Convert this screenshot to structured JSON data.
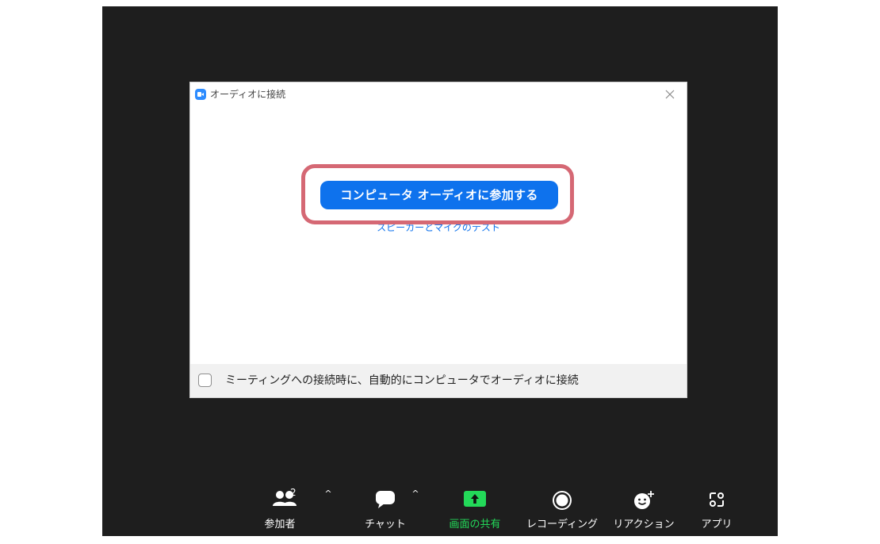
{
  "dialog": {
    "title": "オーディオに接続",
    "join_button_label": "コンピュータ オーディオに参加する",
    "test_link_label": "スピーカーとマイクのテスト",
    "auto_join_label": "ミーティングへの接続時に、自動的にコンピュータでオーディオに接続",
    "auto_join_checked": false
  },
  "toolbar": {
    "participants_label": "参加者",
    "participants_count": "2",
    "chat_label": "チャット",
    "share_label": "画面の共有",
    "record_label": "レコーディング",
    "reactions_label": "リアクション",
    "apps_label": "アプリ",
    "chevron_glyph": "^"
  },
  "colors": {
    "accent_blue": "#0e72ed",
    "share_green": "#23d959",
    "highlight_red": "#d56874",
    "meeting_background": "#1e1e1e"
  }
}
